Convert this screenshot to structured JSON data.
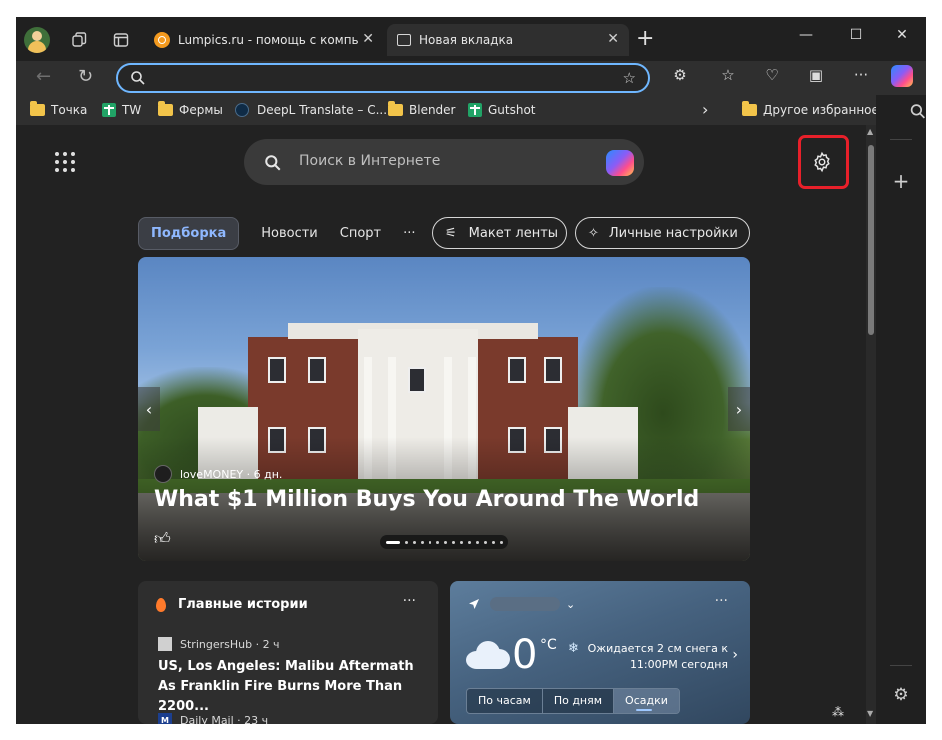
{
  "tabs": [
    {
      "title": "Lumpics.ru - помощь с компьютером",
      "close": "✕"
    },
    {
      "title": "Новая вкладка",
      "close": "✕"
    }
  ],
  "new_tab": "+",
  "window_controls": {
    "minimize": "—",
    "maximize": "☐",
    "close": "✕"
  },
  "address": {
    "placeholder": "",
    "value": ""
  },
  "bookmarks": [
    {
      "label": "Точка",
      "icon": "folder-icon"
    },
    {
      "label": "TW",
      "icon": "sheets-icon"
    },
    {
      "label": "Фермы",
      "icon": "folder-icon"
    },
    {
      "label": "DeepL Translate – C...",
      "icon": "deepl-icon"
    },
    {
      "label": "Blender",
      "icon": "folder-icon"
    },
    {
      "label": "Gutshot",
      "icon": "sheets-icon"
    }
  ],
  "bookmarks_more": "›",
  "other_favorites": "Другое избранное",
  "search": {
    "placeholder": "Поиск в Интернете"
  },
  "feed_tabs": [
    "Подборка",
    "Новости",
    "Спорт",
    "···"
  ],
  "feed_layout_button": "Макет ленты",
  "personalize_button": "Личные настройки",
  "hero": {
    "source": "loveMONEY · 6 дн.",
    "headline": "What $1 Million Buys You Around The World"
  },
  "top_stories": {
    "title": "Главные истории",
    "more": "···",
    "items": [
      {
        "source": "StringersHub · 2 ч",
        "title": "US, Los Angeles: Malibu Aftermath As Franklin Fire Burns More Than 2200..."
      },
      {
        "source": "Daily Mail · 23 ч",
        "title": ""
      }
    ]
  },
  "weather": {
    "more": "···",
    "temp": "0",
    "unit": "°C",
    "forecast": "Ожидается 2 см снега к 11:00PM сегодня",
    "tabs": [
      "По часам",
      "По дням",
      "Осадки"
    ],
    "active_tab": "Осадки"
  },
  "colors": {
    "accent": "#6fb7ff",
    "highlight": "#e8202a",
    "active_pill_text": "#8fb8ff"
  }
}
